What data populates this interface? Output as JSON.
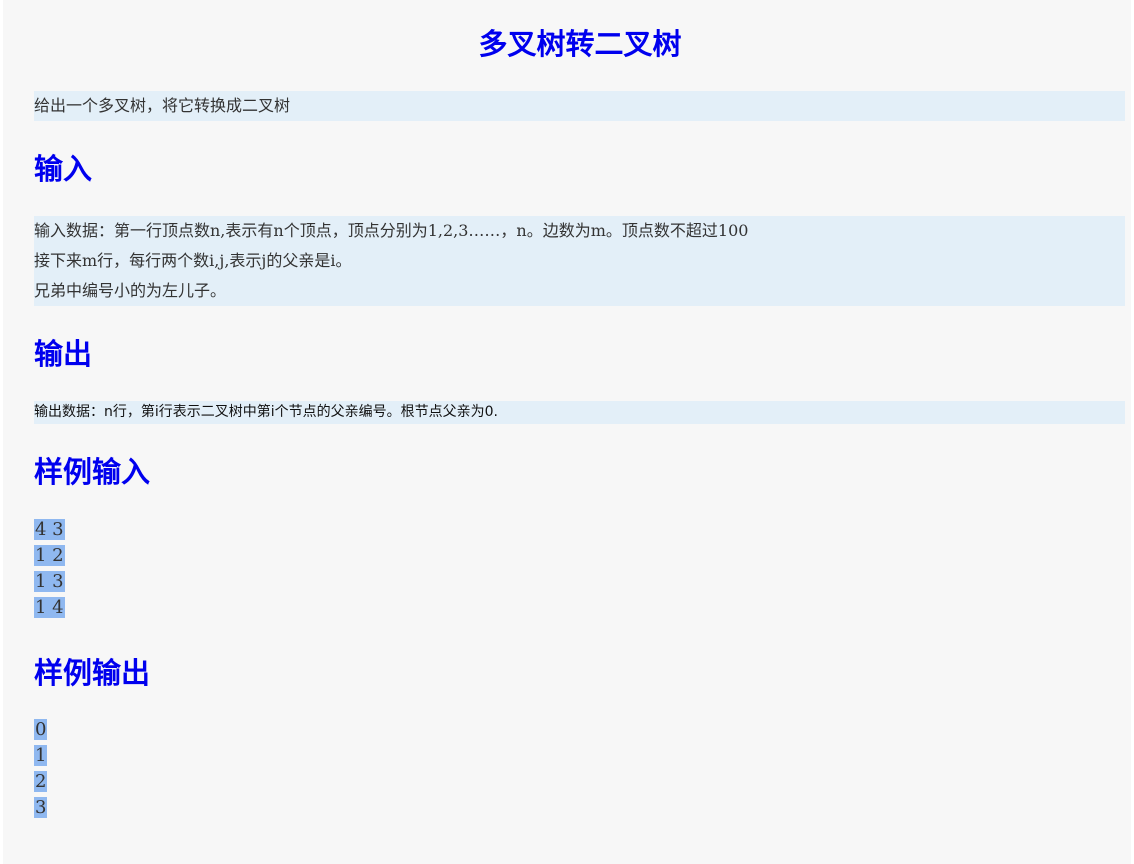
{
  "title": "多叉树转二叉树",
  "description": "给出一个多叉树，将它转换成二叉树",
  "input": {
    "heading": "输入",
    "lines": [
      "输入数据：第一行顶点数n,表示有n个顶点，顶点分别为1,2,3……，n。边数为m。顶点数不超过100",
      "接下来m行，每行两个数i,j,表示j的父亲是i。",
      "兄弟中编号小的为左儿子。"
    ]
  },
  "output": {
    "heading": "输出",
    "text": "输出数据：n行，第i行表示二叉树中第i个节点的父亲编号。根节点父亲为0."
  },
  "sample_input": {
    "heading": "样例输入",
    "lines": [
      "4 3",
      "1 2",
      "1 3",
      "1 4"
    ]
  },
  "sample_output": {
    "heading": "样例输出",
    "lines": [
      "0",
      "1",
      "2",
      "3"
    ]
  },
  "colors": {
    "heading": "#0000ee",
    "box_background": "#e3eff8",
    "sample_highlight": "#8fb8f0",
    "page_background": "#f7f7f7"
  }
}
